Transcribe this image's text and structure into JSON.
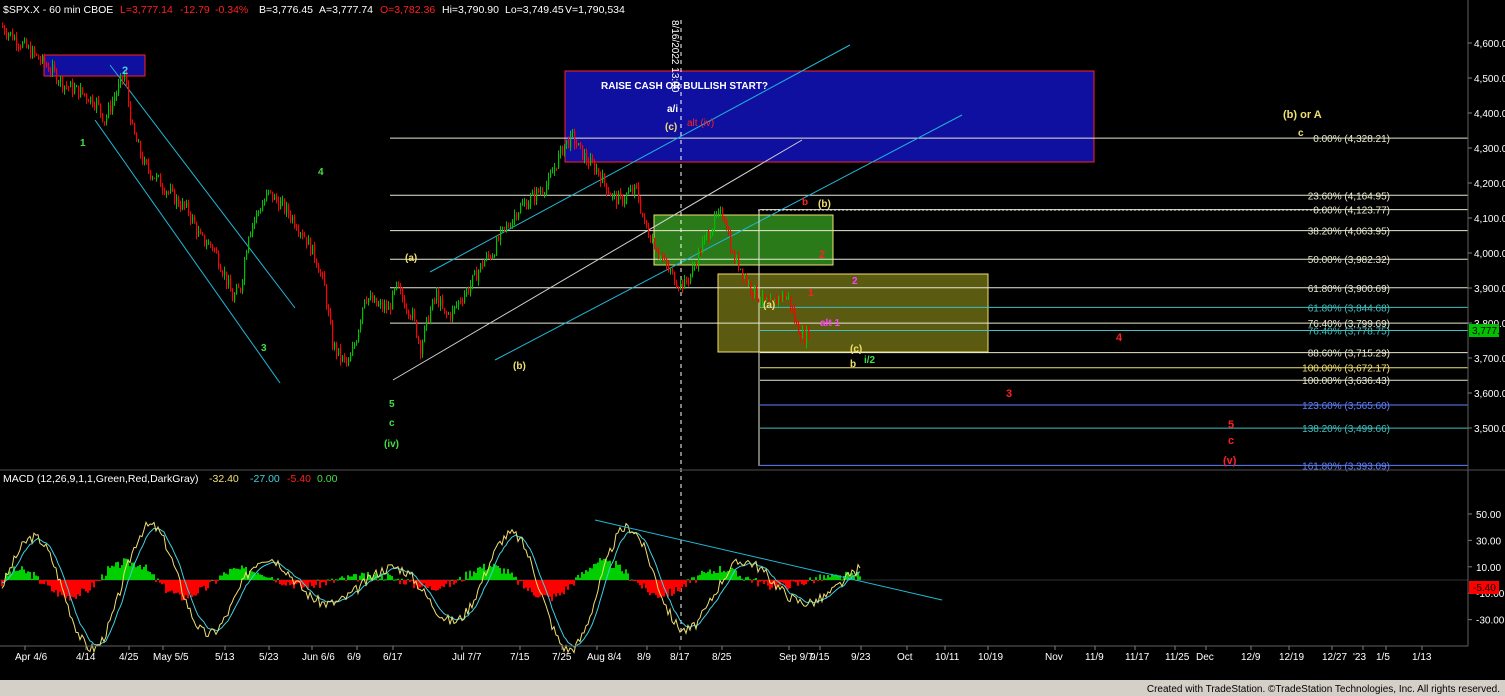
{
  "header": {
    "symbol": "$SPX.X - 60 min  CBOE",
    "last": "L=3,777.14",
    "change": "-12.79",
    "pct": "-0.34%",
    "bid": "B=3,776.45",
    "ask": "A=3,777.74",
    "open": "O=3,782.36",
    "high": "Hi=3,790.90",
    "low": "Lo=3,749.45",
    "volume": "V=1,790,534"
  },
  "colors": {
    "background": "#000000",
    "up": "#00c000",
    "down": "#ff0000",
    "fib_line": "#e0e0c0",
    "channel": "#20b8d8",
    "blue_box": "#1010a0",
    "green_box": "#2a7a1a",
    "yellow_box": "#5a5a10",
    "label_yellow": "#f0e070",
    "label_green": "#40e040",
    "label_red": "#ff2020",
    "label_magenta": "#ff40ff",
    "macd_fast": "#f0e070",
    "macd_slow": "#40d0e0"
  },
  "chart_data": [
    {
      "type": "candlestick",
      "title": "$SPX.X - 60 min",
      "ylim": [
        3370,
        4680
      ],
      "yticks": [
        "4,600.00",
        "4,500.00",
        "4,400.00",
        "4,300.00",
        "4,200.00",
        "4,100.00",
        "4,000.00",
        "3,900.00",
        "3,800.00",
        "3,700.00",
        "3,600.00",
        "3,500.00"
      ],
      "ytick_values": [
        4600,
        4500,
        4400,
        4300,
        4200,
        4100,
        4000,
        3900,
        3800,
        3700,
        3600,
        3500
      ],
      "last_price_label": "3,777.34",
      "last_price": 3777.34,
      "price_path": [
        [
          0,
          4650
        ],
        [
          10,
          4600
        ],
        [
          18,
          4560
        ],
        [
          26,
          4520
        ],
        [
          32,
          4480
        ],
        [
          40,
          4460
        ],
        [
          48,
          4430
        ],
        [
          52,
          4380
        ],
        [
          58,
          4460
        ],
        [
          62,
          4510
        ],
        [
          66,
          4350
        ],
        [
          72,
          4250
        ],
        [
          80,
          4200
        ],
        [
          88,
          4150
        ],
        [
          94,
          4120
        ],
        [
          100,
          4040
        ],
        [
          106,
          4020
        ],
        [
          112,
          3940
        ],
        [
          116,
          3870
        ],
        [
          120,
          3900
        ],
        [
          124,
          4060
        ],
        [
          128,
          4110
        ],
        [
          134,
          4170
        ],
        [
          140,
          4140
        ],
        [
          146,
          4100
        ],
        [
          152,
          4050
        ],
        [
          158,
          3980
        ],
        [
          162,
          3900
        ],
        [
          166,
          3740
        ],
        [
          170,
          3700
        ],
        [
          174,
          3680
        ],
        [
          178,
          3760
        ],
        [
          182,
          3880
        ],
        [
          188,
          3850
        ],
        [
          194,
          3840
        ],
        [
          198,
          3900
        ],
        [
          202,
          3860
        ],
        [
          206,
          3820
        ],
        [
          210,
          3730
        ],
        [
          214,
          3820
        ],
        [
          218,
          3880
        ],
        [
          222,
          3820
        ],
        [
          226,
          3830
        ],
        [
          230,
          3870
        ],
        [
          234,
          3900
        ],
        [
          238,
          3940
        ],
        [
          242,
          3980
        ],
        [
          246,
          4000
        ],
        [
          250,
          4050
        ],
        [
          254,
          4080
        ],
        [
          258,
          4120
        ],
        [
          262,
          4140
        ],
        [
          266,
          4160
        ],
        [
          270,
          4180
        ],
        [
          274,
          4200
        ],
        [
          278,
          4260
        ],
        [
          282,
          4310
        ],
        [
          286,
          4330
        ],
        [
          290,
          4290
        ],
        [
          294,
          4260
        ],
        [
          298,
          4240
        ],
        [
          302,
          4200
        ],
        [
          306,
          4160
        ],
        [
          310,
          4150
        ],
        [
          314,
          4170
        ],
        [
          318,
          4180
        ],
        [
          322,
          4080
        ],
        [
          326,
          4040
        ],
        [
          330,
          3990
        ],
        [
          334,
          3950
        ],
        [
          338,
          3920
        ],
        [
          342,
          3910
        ],
        [
          346,
          3950
        ],
        [
          350,
          4010
        ],
        [
          354,
          4060
        ],
        [
          358,
          4100
        ],
        [
          362,
          4110
        ],
        [
          366,
          3990
        ],
        [
          370,
          3960
        ],
        [
          374,
          3910
        ],
        [
          378,
          3880
        ],
        [
          382,
          3860
        ],
        [
          386,
          3850
        ],
        [
          390,
          3880
        ],
        [
          394,
          3870
        ],
        [
          398,
          3790
        ],
        [
          402,
          3760
        ],
        [
          404,
          3777
        ]
      ],
      "fib_levels": [
        {
          "label": "0.00% (4,328.21)",
          "value": 4328.21,
          "color": "#e8e8d0"
        },
        {
          "label": "23.60% (4,164.95)",
          "value": 4164.95,
          "color": "#e8e8d0"
        },
        {
          "label": "0.00% (4,123.77)",
          "value": 4123.77,
          "color": "#e8e8d0"
        },
        {
          "label": "38.20% (4,063.95)",
          "value": 4063.95,
          "color": "#e8e8d0"
        },
        {
          "label": "50.00% (3,982.32)",
          "value": 3982.32,
          "color": "#e8e8d0"
        },
        {
          "label": "61.80% (3,900.69)",
          "value": 3900.69,
          "color": "#e8e8d0"
        },
        {
          "label": "61.80% (3,844.68)",
          "value": 3844.68,
          "color": "#40c0c0"
        },
        {
          "label": "76.40% (3,799.69)",
          "value": 3799.69,
          "color": "#e8e8d0"
        },
        {
          "label": "76.40% (3,778.75)",
          "value": 3778.75,
          "color": "#40c0c0"
        },
        {
          "label": "88.60% (3,715.29)",
          "value": 3715.29,
          "color": "#e8e8d0"
        },
        {
          "label": "100.00% (3,672.17)",
          "value": 3672.17,
          "color": "#f0e070"
        },
        {
          "label": "100.00% (3,636.43)",
          "value": 3636.43,
          "color": "#e8e8d0"
        },
        {
          "label": "123.60% (3,565.60)",
          "value": 3565.6,
          "color": "#6080ff"
        },
        {
          "label": "138.20% (3,499.66)",
          "value": 3499.66,
          "color": "#40c0c0"
        },
        {
          "label": "161.80% (3,393.09)",
          "value": 3393.09,
          "color": "#6080ff"
        }
      ],
      "annotations": [
        {
          "text": "RAISE CASH OR BULLISH START?",
          "color": "#ffffff",
          "bold": true
        },
        {
          "text": "8/16/2022 13:00",
          "color": "#ffffff",
          "vertical": true
        },
        {
          "text": "(b) or A",
          "color": "#f0e070"
        },
        {
          "text": "c",
          "color": "#f0e070"
        },
        {
          "text": "2",
          "color": "#40d0e0"
        },
        {
          "text": "1",
          "color": "#40e040"
        },
        {
          "text": "4",
          "color": "#40e040"
        },
        {
          "text": "3",
          "color": "#40e040"
        },
        {
          "text": "5",
          "color": "#40e040"
        },
        {
          "text": "c",
          "color": "#40e040"
        },
        {
          "text": "(iv)",
          "color": "#40e040"
        },
        {
          "text": "(a)",
          "color": "#f0e070"
        },
        {
          "text": "(b)",
          "color": "#f0e070"
        },
        {
          "text": "a/i",
          "color": "#ffffff"
        },
        {
          "text": "(c)",
          "color": "#f0e070"
        },
        {
          "text": "alt (iv)",
          "color": "#ff2020"
        },
        {
          "text": "b",
          "color": "#ff2020"
        },
        {
          "text": "(b)",
          "color": "#f0e070"
        },
        {
          "text": "2",
          "color": "#ff2020"
        },
        {
          "text": "(a)",
          "color": "#f0e070"
        },
        {
          "text": "1",
          "color": "#ff2020"
        },
        {
          "text": "2",
          "color": "#ff40ff"
        },
        {
          "text": "alt 1",
          "color": "#ff40ff"
        },
        {
          "text": "(c)",
          "color": "#f0e070"
        },
        {
          "text": "b",
          "color": "#f0e070"
        },
        {
          "text": "i/2",
          "color": "#40e040"
        },
        {
          "text": "4",
          "color": "#ff2020"
        },
        {
          "text": "3",
          "color": "#ff2020"
        },
        {
          "text": "5",
          "color": "#ff2020"
        },
        {
          "text": "c",
          "color": "#ff2020"
        },
        {
          "text": "(v)",
          "color": "#ff2020"
        }
      ]
    },
    {
      "type": "bar",
      "title": "MACD (12,26,9,1,1,Green,Red,DarkGray)",
      "values_text": [
        "-32.40",
        "-27.00",
        "-5.40",
        "0.00"
      ],
      "series": [
        {
          "name": "MACD",
          "value": -32.4
        },
        {
          "name": "Signal",
          "value": -27.0
        },
        {
          "name": "Histogram",
          "value": -5.4
        },
        {
          "name": "Zero",
          "value": 0.0
        }
      ],
      "ylim": [
        -45,
        62
      ],
      "yticks": [
        "50.00",
        "30.00",
        "10.00",
        "-10.00",
        "-30.00"
      ],
      "ytick_values": [
        50,
        30,
        10,
        -10,
        -30
      ],
      "last_value_label": "-5.40"
    }
  ],
  "x_axis": {
    "labels": [
      "Apr 4/6",
      "4/14",
      "4/25",
      "May 5/5",
      "5/13",
      "5/23",
      "Jun 6/6",
      "6/9",
      "6/17",
      "Jul 7/7",
      "7/15",
      "7/25",
      "Aug 8/4",
      "8/9",
      "8/17",
      "8/25",
      "Sep 9/7",
      "9/15",
      "9/23",
      "Oct",
      "10/11",
      "10/19",
      "Nov",
      "11/9",
      "11/17",
      "11/25",
      "Dec",
      "12/9",
      "12/19",
      "12/27",
      "'23",
      "1/5",
      "1/13"
    ]
  },
  "footer": {
    "credit": "Created with TradeStation. ©TradeStation Technologies, Inc. All rights reserved."
  }
}
